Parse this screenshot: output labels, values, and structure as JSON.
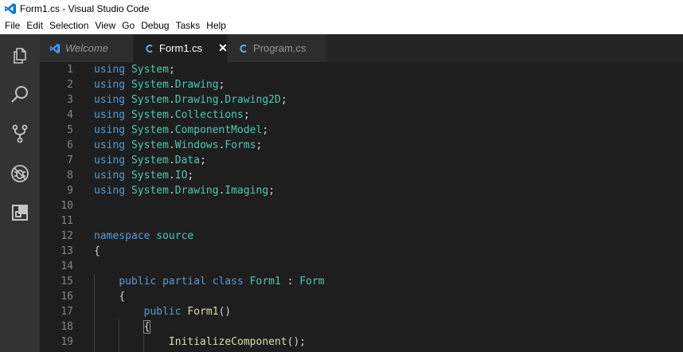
{
  "window": {
    "title": "Form1.cs - Visual Studio Code"
  },
  "menu": [
    "File",
    "Edit",
    "Selection",
    "View",
    "Go",
    "Debug",
    "Tasks",
    "Help"
  ],
  "activity": [
    "explorer-icon",
    "search-icon",
    "source-control-icon",
    "debug-icon",
    "extensions-icon"
  ],
  "tabs": [
    {
      "label": "Welcome",
      "active": false,
      "italic": true,
      "icon": "vscode-logo-icon"
    },
    {
      "label": "Form1.cs",
      "active": true,
      "italic": false,
      "icon": "csharp-file-icon",
      "close": "✕"
    },
    {
      "label": "Program.cs",
      "active": false,
      "italic": false,
      "icon": "csharp-file-icon"
    }
  ],
  "code_lines": [
    {
      "n": "1",
      "indent": "",
      "tokens": [
        [
          "kw",
          "using"
        ],
        [
          "pl",
          " "
        ],
        [
          "ns",
          "System"
        ],
        [
          "pl",
          ";"
        ]
      ]
    },
    {
      "n": "2",
      "indent": "",
      "tokens": [
        [
          "kw",
          "using"
        ],
        [
          "pl",
          " "
        ],
        [
          "ns",
          "System"
        ],
        [
          "pl",
          "."
        ],
        [
          "ns",
          "Drawing"
        ],
        [
          "pl",
          ";"
        ]
      ]
    },
    {
      "n": "3",
      "indent": "",
      "tokens": [
        [
          "kw",
          "using"
        ],
        [
          "pl",
          " "
        ],
        [
          "ns",
          "System"
        ],
        [
          "pl",
          "."
        ],
        [
          "ns",
          "Drawing"
        ],
        [
          "pl",
          "."
        ],
        [
          "ns",
          "Drawing2D"
        ],
        [
          "pl",
          ";"
        ]
      ]
    },
    {
      "n": "4",
      "indent": "",
      "tokens": [
        [
          "kw",
          "using"
        ],
        [
          "pl",
          " "
        ],
        [
          "ns",
          "System"
        ],
        [
          "pl",
          "."
        ],
        [
          "ns",
          "Collections"
        ],
        [
          "pl",
          ";"
        ]
      ]
    },
    {
      "n": "5",
      "indent": "",
      "tokens": [
        [
          "kw",
          "using"
        ],
        [
          "pl",
          " "
        ],
        [
          "ns",
          "System"
        ],
        [
          "pl",
          "."
        ],
        [
          "ns",
          "ComponentModel"
        ],
        [
          "pl",
          ";"
        ]
      ]
    },
    {
      "n": "6",
      "indent": "",
      "tokens": [
        [
          "kw",
          "using"
        ],
        [
          "pl",
          " "
        ],
        [
          "ns",
          "System"
        ],
        [
          "pl",
          "."
        ],
        [
          "ns",
          "Windows"
        ],
        [
          "pl",
          "."
        ],
        [
          "ns",
          "Forms"
        ],
        [
          "pl",
          ";"
        ]
      ]
    },
    {
      "n": "7",
      "indent": "",
      "tokens": [
        [
          "kw",
          "using"
        ],
        [
          "pl",
          " "
        ],
        [
          "ns",
          "System"
        ],
        [
          "pl",
          "."
        ],
        [
          "ns",
          "Data"
        ],
        [
          "pl",
          ";"
        ]
      ]
    },
    {
      "n": "8",
      "indent": "",
      "tokens": [
        [
          "kw",
          "using"
        ],
        [
          "pl",
          " "
        ],
        [
          "ns",
          "System"
        ],
        [
          "pl",
          "."
        ],
        [
          "ns",
          "IO"
        ],
        [
          "pl",
          ";"
        ]
      ]
    },
    {
      "n": "9",
      "indent": "",
      "tokens": [
        [
          "kw",
          "using"
        ],
        [
          "pl",
          " "
        ],
        [
          "ns",
          "System"
        ],
        [
          "pl",
          "."
        ],
        [
          "ns",
          "Drawing"
        ],
        [
          "pl",
          "."
        ],
        [
          "ns",
          "Imaging"
        ],
        [
          "pl",
          ";"
        ]
      ]
    },
    {
      "n": "10",
      "indent": "",
      "tokens": []
    },
    {
      "n": "11",
      "indent": "",
      "tokens": []
    },
    {
      "n": "12",
      "indent": "",
      "tokens": [
        [
          "kw",
          "namespace"
        ],
        [
          "pl",
          " "
        ],
        [
          "ns",
          "source"
        ]
      ]
    },
    {
      "n": "13",
      "indent": "",
      "tokens": [
        [
          "pl",
          "{"
        ]
      ]
    },
    {
      "n": "14",
      "indent": "",
      "tokens": []
    },
    {
      "n": "15",
      "indent": "    ",
      "tokens": [
        [
          "kw",
          "public"
        ],
        [
          "pl",
          " "
        ],
        [
          "kw",
          "partial"
        ],
        [
          "pl",
          " "
        ],
        [
          "kw",
          "class"
        ],
        [
          "pl",
          " "
        ],
        [
          "ns",
          "Form1"
        ],
        [
          "pl",
          " : "
        ],
        [
          "ns",
          "Form"
        ]
      ]
    },
    {
      "n": "16",
      "indent": "    ",
      "tokens": [
        [
          "pl",
          "{"
        ]
      ]
    },
    {
      "n": "17",
      "indent": "        ",
      "tokens": [
        [
          "kw",
          "public"
        ],
        [
          "pl",
          " "
        ],
        [
          "fn",
          "Form1"
        ],
        [
          "pl",
          "()"
        ]
      ]
    },
    {
      "n": "18",
      "indent": "        ",
      "tokens": [
        [
          "pl",
          "{"
        ]
      ]
    },
    {
      "n": "19",
      "indent": "            ",
      "tokens": [
        [
          "fn",
          "InitializeComponent"
        ],
        [
          "pl",
          "();"
        ]
      ]
    }
  ]
}
